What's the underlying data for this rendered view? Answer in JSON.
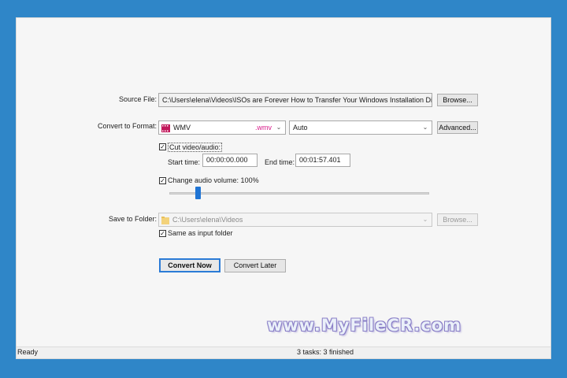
{
  "source": {
    "label": "Source File:",
    "path": "C:\\Users\\elena\\Videos\\ISOs are Forever  How to Transfer Your Windows Installation Discs (Softped",
    "browse_label": "Browse..."
  },
  "format": {
    "label": "Convert to Format:",
    "name": "WMV",
    "ext": ".wmv",
    "preset": "Auto",
    "advanced_label": "Advanced..."
  },
  "cut": {
    "checkbox_label": "Cut video/audio:",
    "checked": true,
    "start_label": "Start time:",
    "start_value": "00:00:00.000",
    "end_label": "End time:",
    "end_value": "00:01:57.401"
  },
  "volume": {
    "checkbox_label": "Change audio volume: 100%",
    "checked": true,
    "level_percent": 100
  },
  "save": {
    "label": "Save to Folder:",
    "folder": "C:\\Users\\elena\\Videos",
    "browse_label": "Browse...",
    "same_folder_label": "Same as input folder",
    "same_folder_checked": true
  },
  "actions": {
    "convert_now": "Convert Now",
    "convert_later": "Convert Later"
  },
  "status": {
    "left": "Ready",
    "center": "3 tasks: 3 finished"
  },
  "watermark": "www.MyFileCR.com",
  "colors": {
    "background": "#2f86c8",
    "accent": "#2b7bd6",
    "format_ext": "#d81b8a",
    "slider_thumb": "#1f74d4"
  },
  "icons": {
    "format": "film-strip-icon",
    "folder": "folder-icon",
    "combo": "chevron-down-icon",
    "check": "checkmark-icon"
  }
}
